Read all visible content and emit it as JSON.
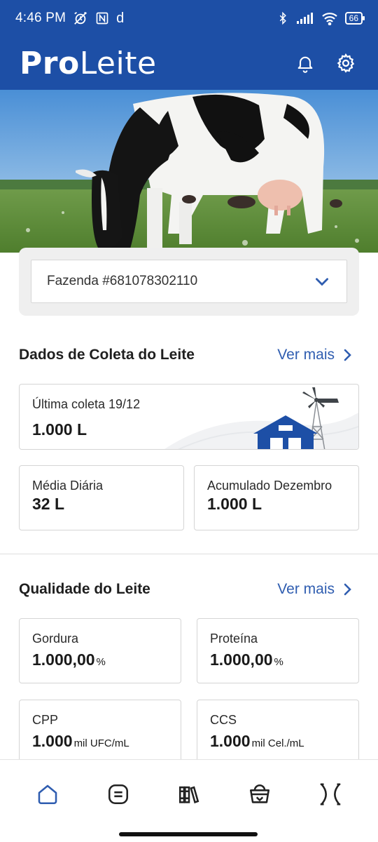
{
  "status_bar": {
    "time": "4:46 PM",
    "battery": "66"
  },
  "app": {
    "brand_bold": "Pro",
    "brand_regular": "Leite"
  },
  "farm_selector": {
    "value": "Fazenda #681078302110"
  },
  "coleta": {
    "title": "Dados de Coleta do Leite",
    "ver_mais": "Ver mais",
    "ultima": {
      "label": "Última coleta 19/12",
      "value": "1.000 L"
    },
    "media": {
      "label": "Média Diária",
      "value": "32 L"
    },
    "acumulado": {
      "label": "Acumulado Dezembro",
      "value": "1.000 L"
    }
  },
  "qualidade": {
    "title": "Qualidade do Leite",
    "ver_mais": "Ver mais",
    "gordura": {
      "label": "Gordura",
      "value": "1.000,00",
      "unit": "%"
    },
    "proteina": {
      "label": "Proteína",
      "value": "1.000,00",
      "unit": "%"
    },
    "cpp": {
      "label": "CPP",
      "value": "1.000",
      "unit": "mil UFC/mL"
    },
    "ccs": {
      "label": "CCS",
      "value": "1.000",
      "unit": "mil Cel./mL"
    }
  },
  "colors": {
    "primary": "#1d4fa6",
    "link": "#2f5db0",
    "nav_active": "#2f5db0"
  },
  "nav": [
    "home-icon",
    "list-icon",
    "books-icon",
    "basket-icon",
    "market-icon"
  ]
}
